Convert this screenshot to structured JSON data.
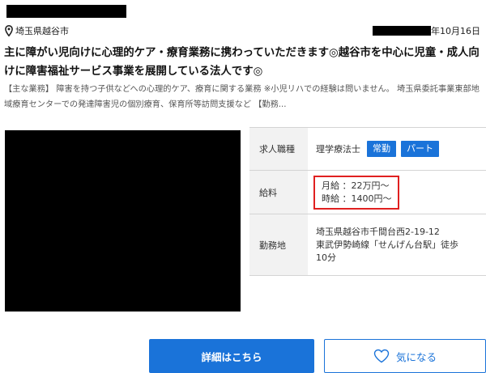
{
  "header": {
    "location": "埼玉県越谷市",
    "date_suffix": "年10月16日"
  },
  "listing": {
    "title": "主に障がい児向けに心理的ケア・療育業務に携わっていただきます◎越谷市を中心に児童・成人向けに障害福祉サービス事業を展開している法人です◎",
    "description": "【主な業務】 障害を持つ子供などへの心理的ケア、療育に関する業務 ※小児リハでの経験は問いません。 埼玉県委託事業東部地域療育センターでの発達障害児の個別療育、保育所等訪問支援など 【勤務..."
  },
  "info": {
    "job_label": "求人職種",
    "job_value": "理学療法士",
    "badges": [
      "常勤",
      "パート"
    ],
    "salary_label": "給料",
    "salary_monthly": "月給 ：22万円～",
    "salary_hourly": "時給 ：1400円～",
    "work_label": "勤務地",
    "address": "埼玉県越谷市千間台西2-19-12",
    "station": "東武伊勢崎線「せんげん台駅」徒歩",
    "walk": "10分"
  },
  "buttons": {
    "detail": "詳細はこちら",
    "favorite": "気になる"
  },
  "colors": {
    "accent": "#1a73d9",
    "highlight_border": "#e02020",
    "table_head_bg": "#f2f2f2"
  },
  "icons": {
    "location": "map-pin-icon",
    "favorite": "heart-outline-icon"
  }
}
